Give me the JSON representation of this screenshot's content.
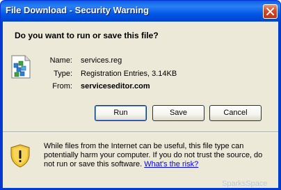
{
  "window": {
    "title": "File Download - Security Warning",
    "close_glyph": "close-icon"
  },
  "dialog": {
    "question": "Do you want to run or save this file?",
    "file_icon": "registry-file-icon",
    "fields": {
      "name_label": "Name:",
      "name_value": "services.reg",
      "type_label": "Type:",
      "type_value": "Registration Entries, 3.14KB",
      "from_label": "From:",
      "from_value": "serviceseditor.com"
    },
    "buttons": {
      "run": "Run",
      "save": "Save",
      "cancel": "Cancel"
    }
  },
  "warning": {
    "icon": "shield-warning-icon",
    "text": "While files from the Internet can be useful, this file type can potentially harm your computer. If you do not trust the source, do not run or save this software. ",
    "link": "What's the risk?"
  },
  "watermark": "SparksSpace",
  "colors": {
    "titlebar": "#0055e5",
    "client": "#ece9d8",
    "close": "#d2482a",
    "link": "#0000ff"
  }
}
